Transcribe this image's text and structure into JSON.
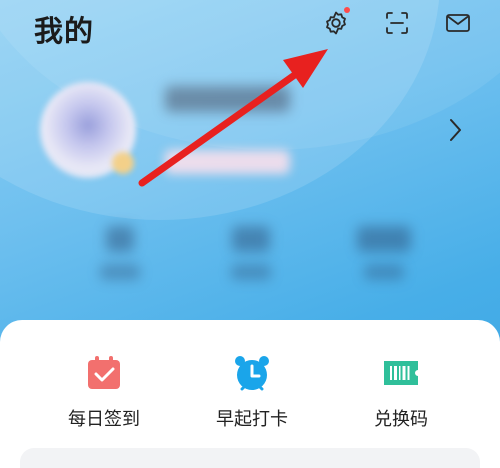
{
  "header": {
    "title": "我的",
    "icons": [
      "gear-icon",
      "scan-icon",
      "mail-icon"
    ],
    "settings_badge_color": "#ff4a4a"
  },
  "profile": {
    "avatar": "avatar-blurred",
    "chevron": "chevron-right-icon"
  },
  "actions": [
    {
      "label": "每日签到",
      "icon": "calendar-check-icon",
      "color": "#f2706e"
    },
    {
      "label": "早起打卡",
      "icon": "alarm-clock-icon",
      "color": "#1aa5ea"
    },
    {
      "label": "兑换码",
      "icon": "barcode-ticket-icon",
      "color": "#2fbf9a"
    }
  ],
  "colors": {
    "background_top": "#8fd0f3",
    "background_bottom": "#3aa4e2",
    "annotation_arrow": "#e8211f"
  }
}
